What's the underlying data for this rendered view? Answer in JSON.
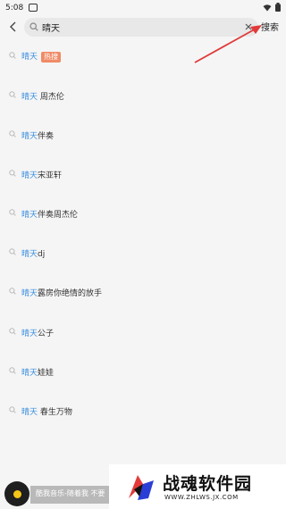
{
  "status_bar": {
    "time": "5:08"
  },
  "search": {
    "query": "晴天",
    "button_label": "搜索"
  },
  "suggestions": [
    {
      "highlight": "晴天",
      "rest": "",
      "badge": "热搜"
    },
    {
      "highlight": "晴天",
      "rest": " 周杰伦"
    },
    {
      "highlight": "晴天",
      "rest": "伴奏"
    },
    {
      "highlight": "晴天",
      "rest": "宋亚轩"
    },
    {
      "highlight": "晴天",
      "rest": "伴奏周杰伦"
    },
    {
      "highlight": "晴天",
      "rest": "dj"
    },
    {
      "highlight": "晴天",
      "rest": "露房你绝情的放手"
    },
    {
      "highlight": "晴天",
      "rest": "公子"
    },
    {
      "highlight": "晴天",
      "rest": "娃娃"
    },
    {
      "highlight": "晴天",
      "rest": " 春生万物"
    }
  ],
  "player": {
    "text": "酷我音乐-随着我 不要"
  },
  "watermark": {
    "title": "战魂软件园",
    "url": "WWW.ZHLWS.JX.COM"
  },
  "colors": {
    "highlight": "#3a8fe0",
    "badge": "#f08a66",
    "arrow": "#e03a3a"
  }
}
